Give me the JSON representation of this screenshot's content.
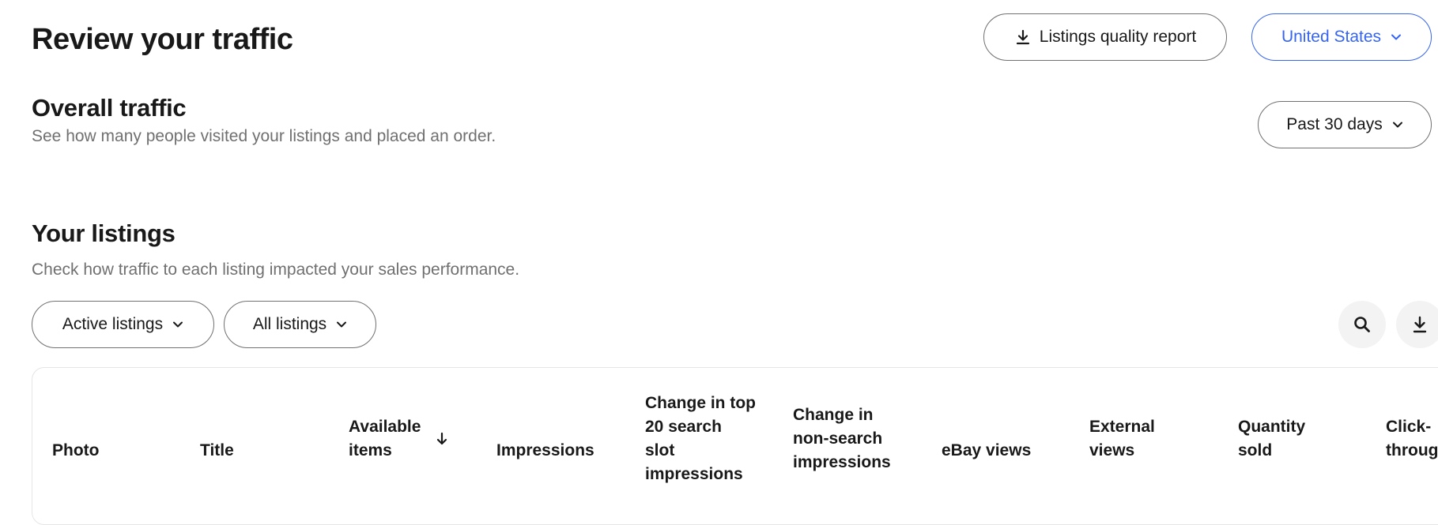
{
  "header": {
    "title": "Review your traffic",
    "report_button": {
      "label": "Listings quality report",
      "icon": "download-icon"
    },
    "region_button": {
      "label": "United States",
      "icon": "chevron-down-icon"
    }
  },
  "overall": {
    "title": "Overall traffic",
    "subtitle": "See how many people visited your listings and placed an order.",
    "period_button": {
      "label": "Past 30 days",
      "icon": "chevron-down-icon"
    }
  },
  "listings": {
    "title": "Your listings",
    "subtitle": "Check how traffic to each listing impacted your sales performance.",
    "filters": [
      {
        "label": "Active listings",
        "icon": "chevron-down-icon"
      },
      {
        "label": "All listings",
        "icon": "chevron-down-icon"
      }
    ],
    "actions": [
      {
        "icon": "search-icon"
      },
      {
        "icon": "download-icon"
      }
    ],
    "columns": [
      {
        "label": "Photo"
      },
      {
        "label": "Title"
      },
      {
        "label": "Available items",
        "sort": "descending",
        "icon": "arrow-down-icon"
      },
      {
        "label": "Impressions"
      },
      {
        "label": "Change in top 20 search slot impressions"
      },
      {
        "label": "Change in non-search impressions"
      },
      {
        "label": "eBay views"
      },
      {
        "label": "External views"
      },
      {
        "label": "Quantity sold"
      },
      {
        "label": "Click-through"
      }
    ]
  },
  "colors": {
    "text": "#191919",
    "muted": "#707070",
    "accent": "#3665f3",
    "border": "#707070",
    "icon_bg": "#f3f3f3"
  }
}
